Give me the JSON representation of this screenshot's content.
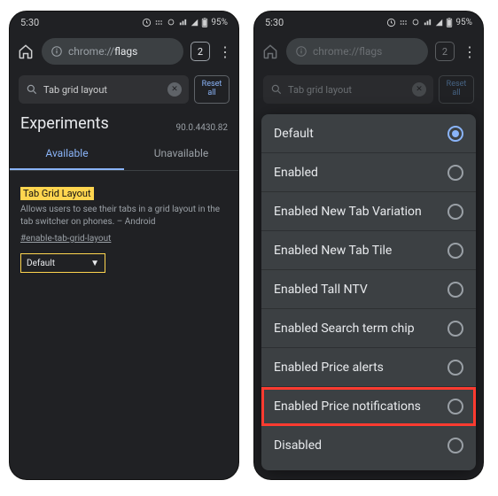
{
  "status": {
    "time": "5:30",
    "battery": "95%"
  },
  "url": {
    "prefix": "chrome://",
    "path": "flags"
  },
  "tab_count": "2",
  "search": {
    "value": "Tab grid layout"
  },
  "reset": {
    "line1": "Reset",
    "line2": "all"
  },
  "experiments": {
    "title": "Experiments",
    "version": "90.0.4430.82"
  },
  "tabs": {
    "available": "Available",
    "unavailable": "Unavailable"
  },
  "flag": {
    "name": "Tab Grid Layout",
    "description": "Allows users to see their tabs in a grid layout in the tab switcher on phones. – Android",
    "id": "#enable-tab-grid-layout",
    "selected": "Default"
  },
  "options": [
    {
      "label": "Default",
      "selected": true
    },
    {
      "label": "Enabled",
      "selected": false
    },
    {
      "label": "Enabled New Tab Variation",
      "selected": false
    },
    {
      "label": "Enabled New Tab Tile",
      "selected": false
    },
    {
      "label": "Enabled Tall NTV",
      "selected": false
    },
    {
      "label": "Enabled Search term chip",
      "selected": false
    },
    {
      "label": "Enabled Price alerts",
      "selected": false
    },
    {
      "label": "Enabled Price notifications",
      "selected": false,
      "highlight": true
    },
    {
      "label": "Disabled",
      "selected": false
    }
  ]
}
